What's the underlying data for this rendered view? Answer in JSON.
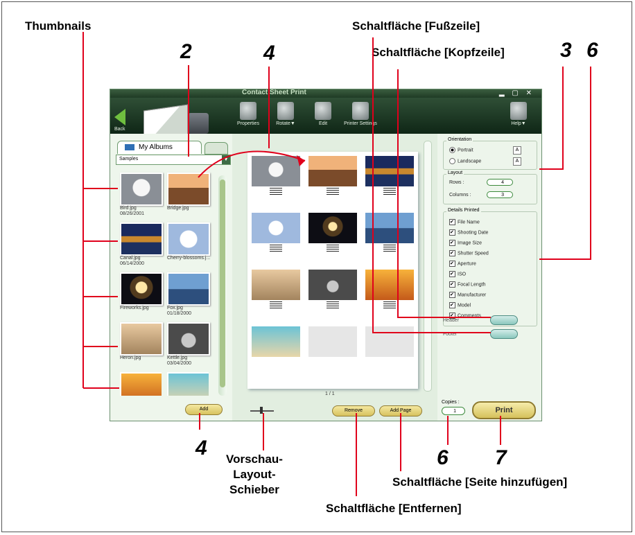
{
  "callouts": {
    "thumbnails": "Thumbnails",
    "footer_button": "Schaltfläche [Fußzeile]",
    "header_button": "Schaltfläche [Kopfzeile]",
    "preview_slider": "Vorschau-\nLayout-\nSchieber",
    "add_page_button": "Schaltfläche [Seite hinzufügen]",
    "remove_button": "Schaltfläche [Entfernen]",
    "num_2": "2",
    "num_3": "3",
    "num_4_top": "4",
    "num_4_bottom": "4",
    "num_6_top": "6",
    "num_6_bottom": "6",
    "num_7": "7"
  },
  "app": {
    "title": "Contact Sheet Print",
    "window_buttons": "▂ ▢ ✕",
    "toolbar": {
      "back": "Back",
      "properties": "Properties",
      "rotate": "Rotate▼",
      "edit": "Edit",
      "printer_settings": "Printer Settings",
      "help": "Help▼"
    },
    "left": {
      "tab_label": "My Albums",
      "album_value": "Samples",
      "thumbnails": [
        {
          "caption": "Bird.jpg\n08/26/2001"
        },
        {
          "caption": "Bridge.jpg"
        },
        {
          "caption": "Canal.jpg\n06/14/2000"
        },
        {
          "caption": "Cherry-blossoms.j..."
        },
        {
          "caption": "Fireworks.jpg"
        },
        {
          "caption": "Fox.jpg\n01/18/2000"
        },
        {
          "caption": "Heron.jpg"
        },
        {
          "caption": "Kettle.jpg\n03/04/2000"
        },
        {
          "caption": ""
        },
        {
          "caption": ""
        }
      ],
      "add_label": "Add"
    },
    "center": {
      "page_indicator": "1 / 1",
      "remove_label": "Remove",
      "add_page_label": "Add Page"
    },
    "right": {
      "orientation_title": "Orientation",
      "portrait": "Portrait",
      "landscape": "Landscape",
      "layout_title": "Layout",
      "rows_label": "Rows :",
      "rows_value": "4",
      "columns_label": "Columns :",
      "columns_value": "3",
      "details_title": "Details Printed",
      "details": [
        "File Name",
        "Shooting Date",
        "Image Size",
        "Shutter Speed",
        "Aperture",
        "ISO",
        "Focal Length",
        "Manufacturer",
        "Model",
        "Comments"
      ],
      "header_label": "Header",
      "footer_label": "Footer",
      "copies_label": "Copies :",
      "copies_value": "1",
      "print_label": "Print"
    }
  }
}
